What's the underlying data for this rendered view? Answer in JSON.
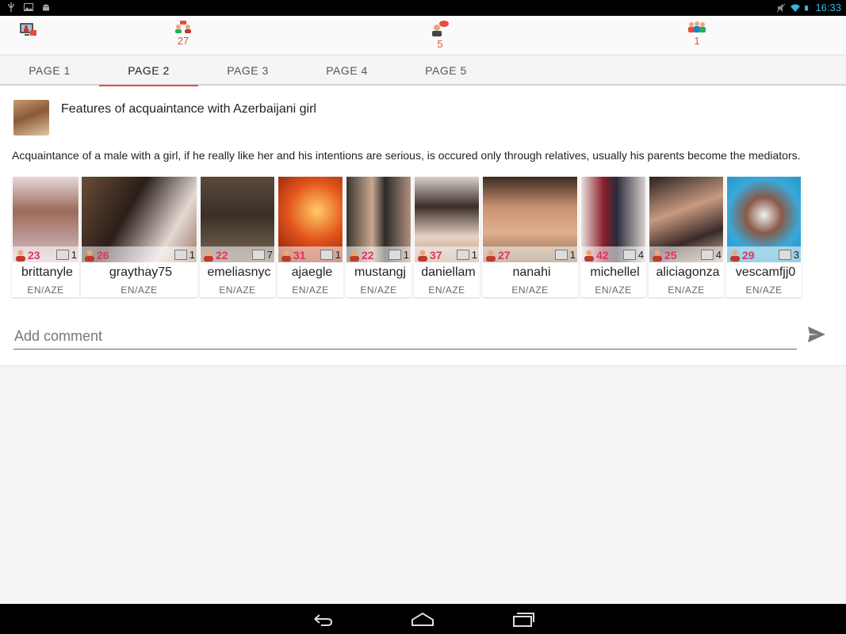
{
  "status_bar": {
    "time": "16:33",
    "left_icons": [
      "usb-icon",
      "image-icon",
      "android-icon"
    ],
    "right_icons": [
      "mute-icon",
      "wifi-icon",
      "battery-icon"
    ]
  },
  "topbar": {
    "items": [
      {
        "icon": "profile-screen-icon",
        "count": ""
      },
      {
        "icon": "visitors-icon",
        "count": "27"
      },
      {
        "icon": "messages-icon",
        "count": "5"
      },
      {
        "icon": "friends-icon",
        "count": "1"
      }
    ]
  },
  "tabs": [
    {
      "label": "PAGE 1",
      "active": false
    },
    {
      "label": "PAGE 2",
      "active": true
    },
    {
      "label": "PAGE 3",
      "active": false
    },
    {
      "label": "PAGE 4",
      "active": false
    },
    {
      "label": "PAGE 5",
      "active": false
    }
  ],
  "post": {
    "title": "Features of acquaintance with Azerbaijani girl",
    "body": "Acquaintance of a male with a girl, if he really like her and his intentions are serious, is occured only through relatives, usually his parents become the mediators."
  },
  "users": [
    {
      "name": "brittanyle",
      "age": "23",
      "photos": "1",
      "lang": "EN/AZE"
    },
    {
      "name": "graythay75",
      "age": "26",
      "photos": "1",
      "lang": "EN/AZE"
    },
    {
      "name": "emeliasnyc",
      "age": "22",
      "photos": "7",
      "lang": "EN/AZE"
    },
    {
      "name": "ajaegle",
      "age": "31",
      "photos": "1",
      "lang": "EN/AZE"
    },
    {
      "name": "mustangj",
      "age": "22",
      "photos": "1",
      "lang": "EN/AZE"
    },
    {
      "name": "daniellam",
      "age": "37",
      "photos": "1",
      "lang": "EN/AZE"
    },
    {
      "name": "nanahi",
      "age": "27",
      "photos": "1",
      "lang": "EN/AZE"
    },
    {
      "name": "michellel",
      "age": "42",
      "photos": "4",
      "lang": "EN/AZE"
    },
    {
      "name": "aliciagonza",
      "age": "25",
      "photos": "4",
      "lang": "EN/AZE"
    },
    {
      "name": "vescamfjj0",
      "age": "29",
      "photos": "3",
      "lang": "EN/AZE"
    }
  ],
  "comment": {
    "placeholder": "Add comment",
    "value": ""
  },
  "colors": {
    "accent": "#e0533f",
    "age": "#e2335e",
    "status_blue": "#33b5e5"
  },
  "nav": [
    "back-icon",
    "home-icon",
    "recents-icon"
  ]
}
